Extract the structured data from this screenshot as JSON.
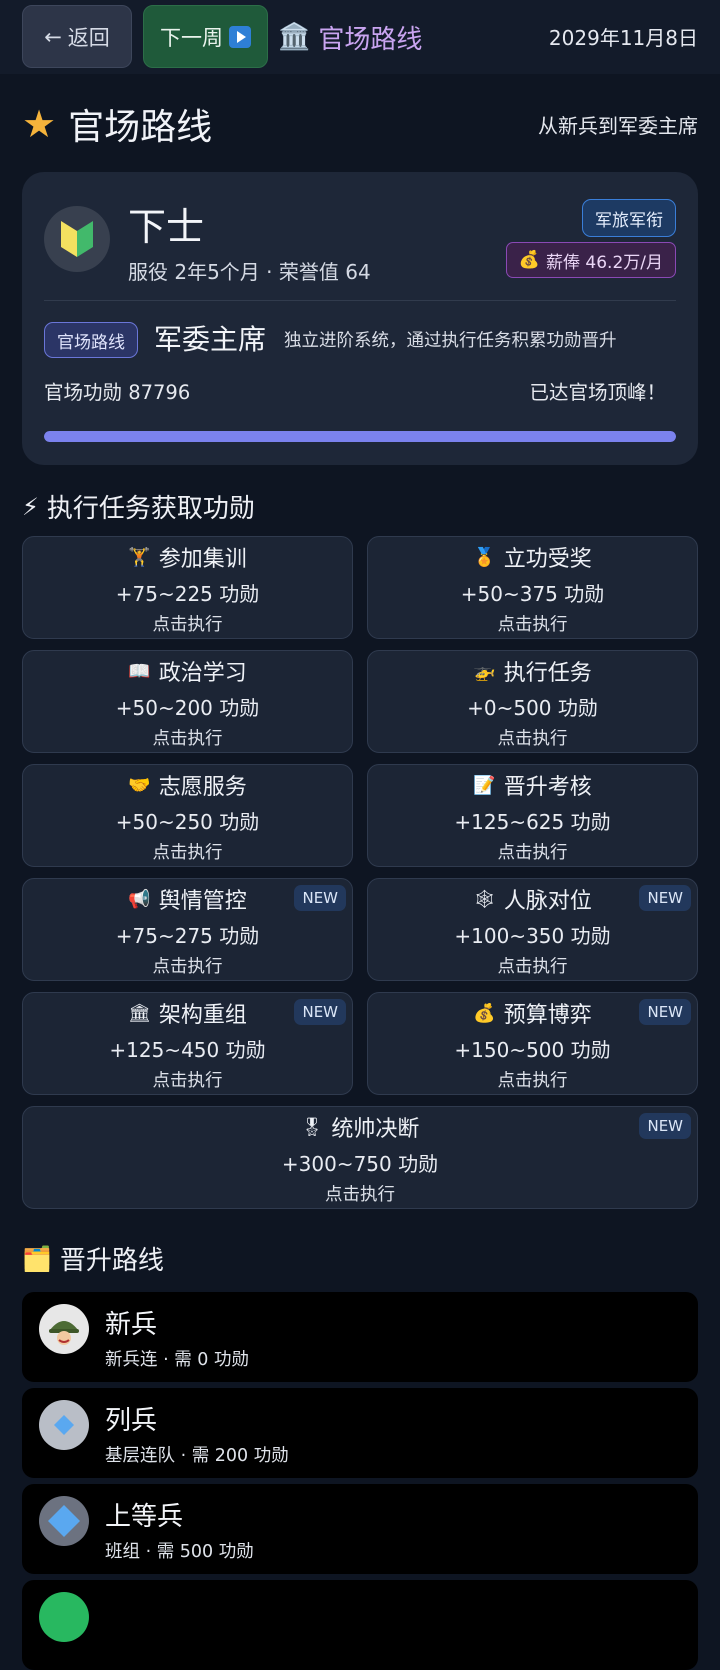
{
  "topbar": {
    "back_label": "返回",
    "next_label": "下一周",
    "title": "官场路线",
    "date": "2029年11月8日"
  },
  "page": {
    "title": "官场路线",
    "subtitle": "从新兵到军委主席"
  },
  "rank_card": {
    "rank": "下士",
    "service": "服役 2年5个月",
    "honor": "荣誉值 64",
    "branch_chip": "军旅军衔",
    "salary_chip": "薪俸 46.2万/月",
    "route_tag": "官场路线",
    "route_top": "军委主席",
    "route_desc": "独立进阶系统，通过执行任务积累功勋晋升",
    "merit": "官场功勋 87796",
    "status": "已达官场顶峰！",
    "progress": 1.0
  },
  "tasks_section": {
    "title": "执行任务获取功勋",
    "icon": "lightning-icon"
  },
  "tasks": [
    {
      "name": "参加集训",
      "emoji": "🏋",
      "reward": "+75~225 功勋",
      "action": "点击执行",
      "is_new": false
    },
    {
      "name": "立功受奖",
      "emoji": "🏅",
      "reward": "+50~375 功勋",
      "action": "点击执行",
      "is_new": false
    },
    {
      "name": "政治学习",
      "emoji": "📖",
      "reward": "+50~200 功勋",
      "action": "点击执行",
      "is_new": false
    },
    {
      "name": "执行任务",
      "emoji": "🚁",
      "reward": "+0~500 功勋",
      "action": "点击执行",
      "is_new": false
    },
    {
      "name": "志愿服务",
      "emoji": "🤝",
      "reward": "+50~250 功勋",
      "action": "点击执行",
      "is_new": false
    },
    {
      "name": "晋升考核",
      "emoji": "📝",
      "reward": "+125~625 功勋",
      "action": "点击执行",
      "is_new": false
    },
    {
      "name": "舆情管控",
      "emoji": "📢",
      "reward": "+75~275 功勋",
      "action": "点击执行",
      "is_new": true
    },
    {
      "name": "人脉对位",
      "emoji": "🕸",
      "reward": "+100~350 功勋",
      "action": "点击执行",
      "is_new": true
    },
    {
      "name": "架构重组",
      "emoji": "🏛",
      "reward": "+125~450 功勋",
      "action": "点击执行",
      "is_new": true
    },
    {
      "name": "预算博弈",
      "emoji": "💰",
      "reward": "+150~500 功勋",
      "action": "点击执行",
      "is_new": true
    },
    {
      "name": "统帅决断",
      "emoji": "🎖",
      "reward": "+300~750 功勋",
      "action": "点击执行",
      "is_new": true
    }
  ],
  "new_badge_label": "NEW",
  "ranks_section": {
    "title": "晋升路线",
    "icon": "folder-icon"
  },
  "ranks": [
    {
      "name": "新兵",
      "unit": "新兵连",
      "requirement": "需 0 功勋",
      "icon": "soldier-helmet-icon",
      "color": "#e7e7e7"
    },
    {
      "name": "列兵",
      "unit": "基层连队",
      "requirement": "需 200 功勋",
      "icon": "small-diamond-icon",
      "color": "#b9bec7"
    },
    {
      "name": "上等兵",
      "unit": "班组",
      "requirement": "需 500 功勋",
      "icon": "large-diamond-icon",
      "color": "#6c7280"
    },
    {
      "name": "",
      "unit": "",
      "requirement": "",
      "icon": "green-circle-icon",
      "color": "#28b860"
    }
  ]
}
